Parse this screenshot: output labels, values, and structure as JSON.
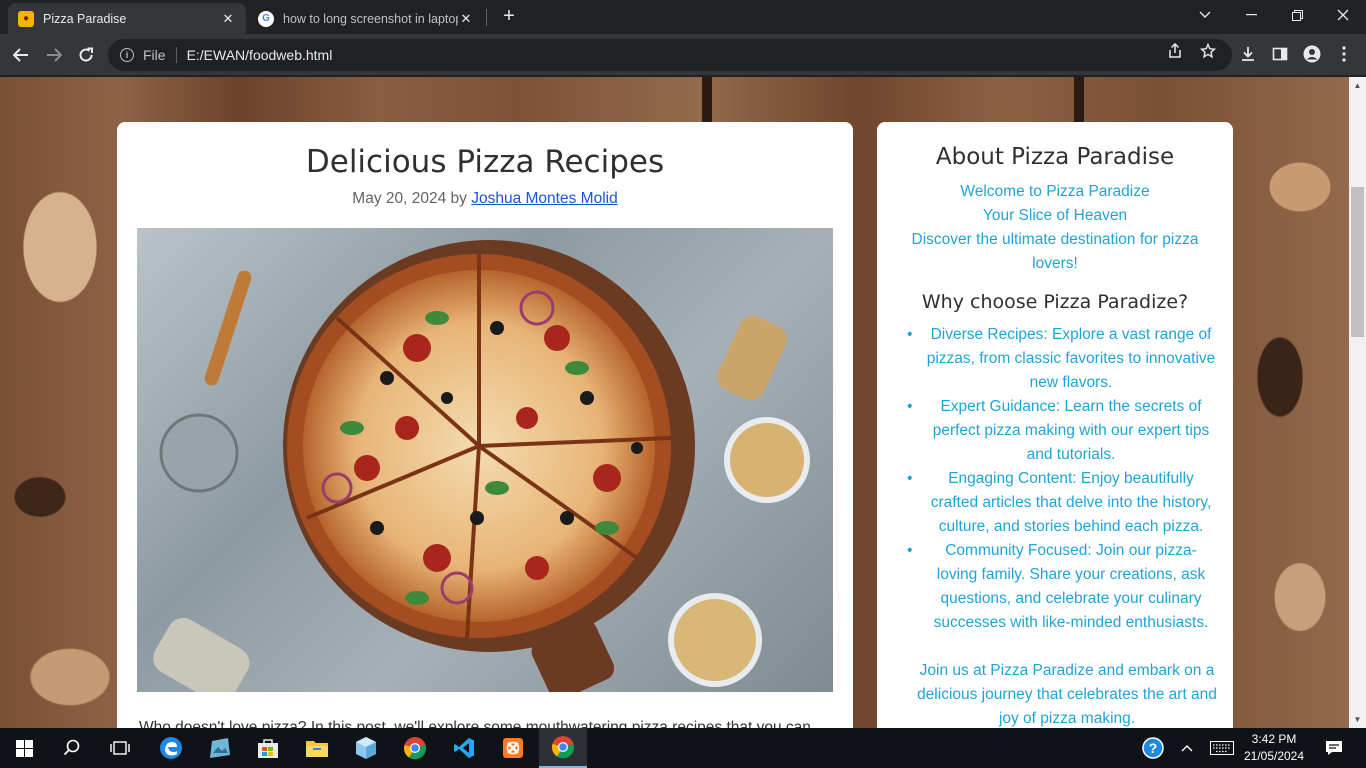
{
  "browser": {
    "tabs": [
      {
        "title": "Pizza Paradise",
        "active": true
      },
      {
        "title": "how to long screenshot in laptop",
        "active": false
      }
    ],
    "address": {
      "scheme": "File",
      "url": "E:/EWAN/foodweb.html"
    }
  },
  "post": {
    "title": "Delicious Pizza Recipes",
    "date": "May 20, 2024",
    "by": "by",
    "author": "Joshua Montes Molid",
    "intro": "Who doesn't love pizza? In this post, we'll explore some mouthwatering pizza recipes that you can"
  },
  "sidebar": {
    "title": "About Pizza Paradise",
    "welcome_lines": [
      "Welcome to Pizza Paradize",
      "Your Slice of Heaven",
      "Discover the ultimate destination for pizza lovers!"
    ],
    "why_title": "Why choose Pizza Paradize?",
    "reasons": [
      "Diverse Recipes: Explore a vast range of pizzas, from classic favorites to innovative new flavors.",
      "Expert Guidance: Learn the secrets of perfect pizza making with our expert tips and tutorials.",
      "Engaging Content: Enjoy beautifully crafted articles that delve into the history, culture, and stories behind each pizza.",
      "Community Focused: Join our pizza-loving family. Share your creations, ask questions, and celebrate your culinary successes with like-minded enthusiasts."
    ],
    "join": "Join us at Pizza Paradize and embark on a delicious journey that celebrates the art and joy of pizza making."
  },
  "taskbar": {
    "time": "3:42 PM",
    "date": "21/05/2024"
  },
  "colors": {
    "accent_link": "#20a4d6",
    "author_link": "#1a55d6",
    "chrome_dark": "#202124",
    "chrome_toolbar": "#35363a",
    "taskbar": "#0f1318"
  }
}
